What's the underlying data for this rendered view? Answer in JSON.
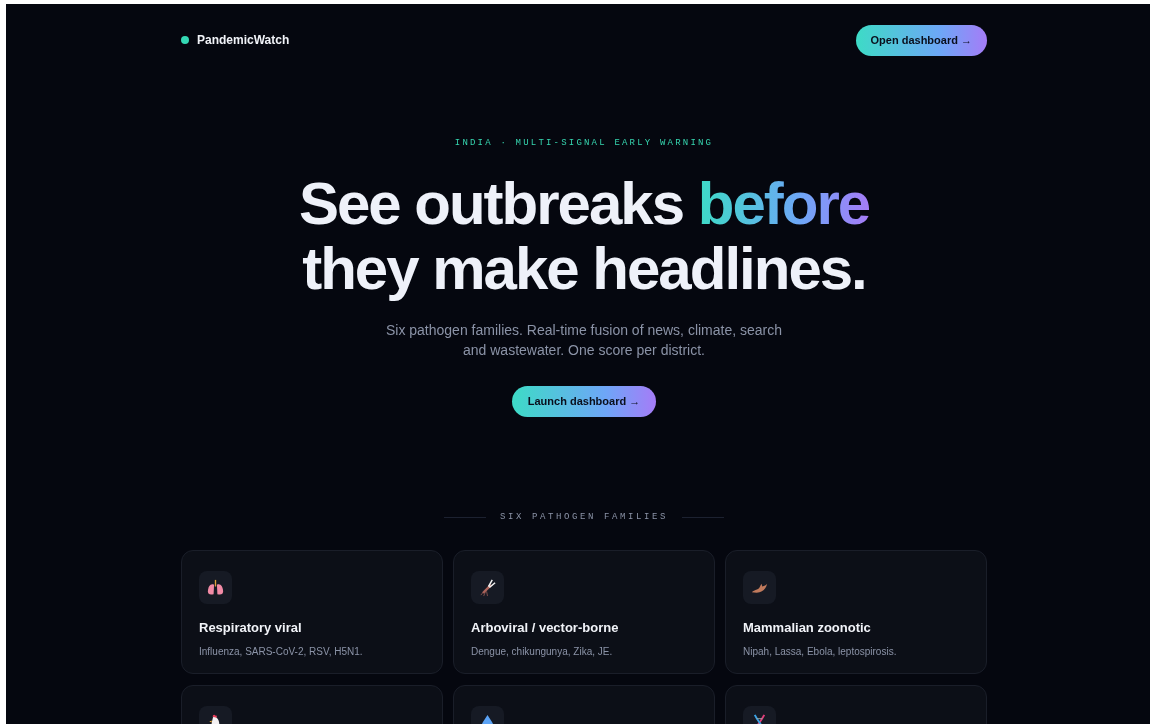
{
  "brand": {
    "name": "PandemicWatch"
  },
  "nav_button": "Open dashboard →",
  "hero": {
    "eyebrow": "INDIA · MULTI-SIGNAL EARLY WARNING",
    "headline_start": "See outbreaks ",
    "headline_highlight": "before",
    "headline_end": "they make headlines.",
    "subtitle": "Six pathogen families. Real-time fusion of news, climate, search and wastewater. One score per district.",
    "button": "Launch dashboard →"
  },
  "section_label": "SIX PATHOGEN FAMILIES",
  "families": [
    {
      "kind": "full",
      "title": "Respiratory viral",
      "description": "Influenza, SARS-CoV-2, RSV, H5N1."
    },
    {
      "kind": "full",
      "title": "Arboviral / vector-borne",
      "description": "Dengue, chikungunya, Zika, JE."
    },
    {
      "kind": "full",
      "title": "Mammalian zoonotic",
      "description": "Nipah, Lassa, Ebola, leptospirosis."
    },
    {
      "kind": "cut"
    },
    {
      "kind": "cut"
    },
    {
      "kind": "cut"
    }
  ]
}
